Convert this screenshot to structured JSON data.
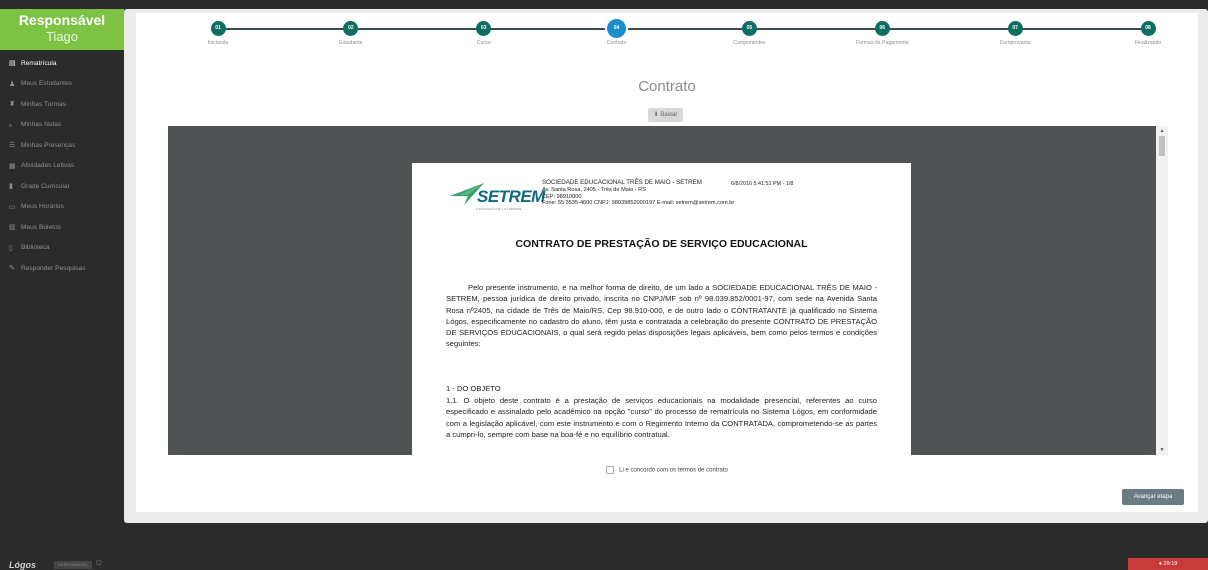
{
  "sidebar": {
    "profile_role": "Responsável",
    "profile_name": "Tiago",
    "items": [
      {
        "label": "Rematrícula",
        "icon": "document-icon",
        "active": true
      },
      {
        "label": "Meus Estudantes",
        "icon": "user-icon",
        "active": false
      },
      {
        "label": "Minhas Turmas",
        "icon": "graduation-icon",
        "active": false
      },
      {
        "label": "Minhas Notas",
        "icon": "grades-icon",
        "active": false
      },
      {
        "label": "Minhas Presenças",
        "icon": "list-icon",
        "active": false
      },
      {
        "label": "Atividades Letivas",
        "icon": "board-icon",
        "active": false
      },
      {
        "label": "Grade Curricular",
        "icon": "book-icon",
        "active": false
      },
      {
        "label": "Meus Horários",
        "icon": "calendar-icon",
        "active": false
      },
      {
        "label": "Meus Boletos",
        "icon": "barcode-icon",
        "active": false
      },
      {
        "label": "Biblioteca",
        "icon": "library-icon",
        "active": false
      },
      {
        "label": "Responder Pesquisas",
        "icon": "edit-icon",
        "active": false
      }
    ]
  },
  "stepper": [
    {
      "num": "01",
      "label": "Iniciando"
    },
    {
      "num": "02",
      "label": "Estudante"
    },
    {
      "num": "03",
      "label": "Curso"
    },
    {
      "num": "04",
      "label": "Contrato"
    },
    {
      "num": "05",
      "label": "Componentes"
    },
    {
      "num": "06",
      "label": "Formas de Pagamento"
    },
    {
      "num": "07",
      "label": "Comprovante"
    },
    {
      "num": "08",
      "label": "Finalizando"
    }
  ],
  "active_step": 4,
  "main": {
    "title": "Contrato",
    "download_label": "⬇ Baixar",
    "agree_label": "Li e concordo com os termos de contrato",
    "next_label": "Avançar etapa"
  },
  "document": {
    "logo_text": "SETREM",
    "logo_tagline": "A EDUCAÇÃO DE 1 A 1 SEMPRE",
    "company_line1": "SOCIEDADE EDUCACIONAL TRÊS DE MAIO - SETREM",
    "company_line2": "Av. Santa Rosa, 2405 - Três de Maio - RS",
    "company_line3": "CEP: 98910000",
    "company_line4": "Fone: 55 3535-4600    CNPJ: 98039852000197    E-mail: setrem@setrem.com.br",
    "stamp": "6/8/2016 5:41:51 PM - 1/8",
    "title": "CONTRATO DE PRESTAÇÃO DE SERVIÇO EDUCACIONAL",
    "paragraph1": "Pelo presente instrumento, e na melhor forma de direito, de um lado a SOCIEDADE EDUCACIONAL TRÊS DE MAIO - SETREM, pessoa jurídica de direito privado, inscrita no CNPJ/MF sob nº 98.039.852/0001-97, com sede na Avenida Santa Rosa nº2405, na cidade de Três de Maio/RS, Cep 98.910-000, e de outro lado o CONTRATANTE já qualificado no Sistema Lógos, especificamente no cadastro do aluno, têm justa e contratada a celebração do presente CONTRATO DE PRESTAÇÃO DE SERVIÇOS EDUCACIONAIS, o qual será regido pelas disposições legais aplicáveis, bem como pelos termos e condições seguintes:",
    "section1": "1 - DO OBJETO",
    "paragraph2": "1.1. O objeto deste contrato é a prestação de serviços educacionais na modalidade presencial, referentes ao curso especificado e assinalado pelo acadêmico na opção \"curso\" do processo de rematrícula no Sistema Lógos, em conformidade com a legislação aplicável, com este instrumento e com o Regimento Interno da CONTRATADA, comprometendo-se as partes a cumpri-lo, sempre com base na boa-fé e no equilíbrio contratual."
  },
  "footer": {
    "brand": "Lógos",
    "badge": "RESPONSÁVEL",
    "timer": "29:19"
  },
  "colors": {
    "sidebar_accent": "#7dc243",
    "step_done": "#0e6e62",
    "step_active": "#1a8ec8",
    "timer_bg": "#c73b3b"
  }
}
